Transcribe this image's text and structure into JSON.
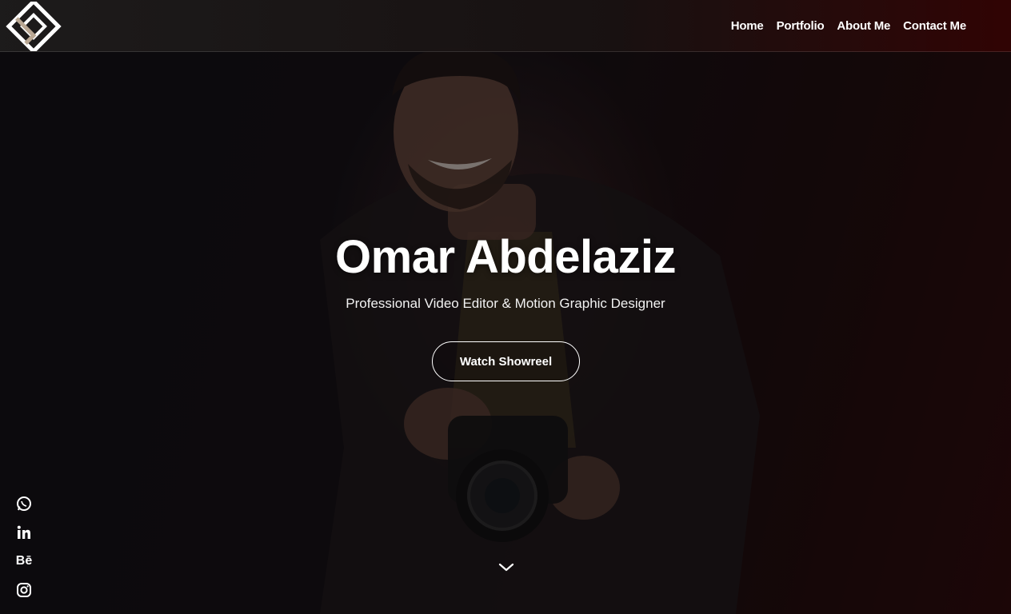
{
  "nav": {
    "items": [
      {
        "label": "Home"
      },
      {
        "label": "Portfolio"
      },
      {
        "label": "About Me"
      },
      {
        "label": "Contact Me"
      }
    ]
  },
  "hero": {
    "title": "Omar Abdelaziz",
    "subtitle": "Professional Video Editor & Motion Graphic Designer",
    "cta_label": "Watch Showreel"
  },
  "social": {
    "icons": [
      "whatsapp-icon",
      "linkedin-icon",
      "behance-icon",
      "instagram-icon"
    ],
    "behance_text": "Bē"
  },
  "colors": {
    "accent_dark_red": "#2a0505",
    "text": "#ffffff"
  }
}
